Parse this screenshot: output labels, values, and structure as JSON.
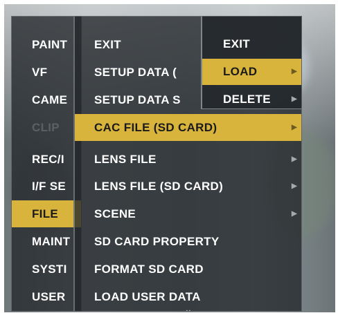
{
  "menu_level1": {
    "items": [
      {
        "label": "PAINT"
      },
      {
        "label": "VF"
      },
      {
        "label": "CAME"
      },
      {
        "label": "CLIP"
      },
      {
        "label": "REC/I"
      },
      {
        "label": "I/F SE"
      },
      {
        "label": "FILE"
      },
      {
        "label": "MAINT"
      },
      {
        "label": "SYSTI"
      },
      {
        "label": "USER"
      }
    ]
  },
  "menu_level2": {
    "items": [
      {
        "label": "EXIT",
        "arrow": ""
      },
      {
        "label": "SETUP DATA (",
        "arrow": ""
      },
      {
        "label": "SETUP DATA S",
        "arrow": ""
      },
      {
        "label": "CAC FILE (SD CARD)",
        "arrow": "▶"
      },
      {
        "label": "LENS FILE",
        "arrow": "▶"
      },
      {
        "label": "LENS FILE (SD CARD)",
        "arrow": "▶"
      },
      {
        "label": "SCENE",
        "arrow": "▶"
      },
      {
        "label": "SD CARD PROPERTY",
        "arrow": ""
      },
      {
        "label": "FORMAT SD CARD",
        "arrow": ""
      },
      {
        "label": "LOAD USER DATA",
        "arrow": ""
      }
    ],
    "scroll_indicator": "⌄"
  },
  "menu_level3": {
    "items": [
      {
        "label": "EXIT",
        "arrow": ""
      },
      {
        "label": "LOAD",
        "arrow": "▶"
      },
      {
        "label": "DELETE",
        "arrow": "▶"
      }
    ]
  }
}
